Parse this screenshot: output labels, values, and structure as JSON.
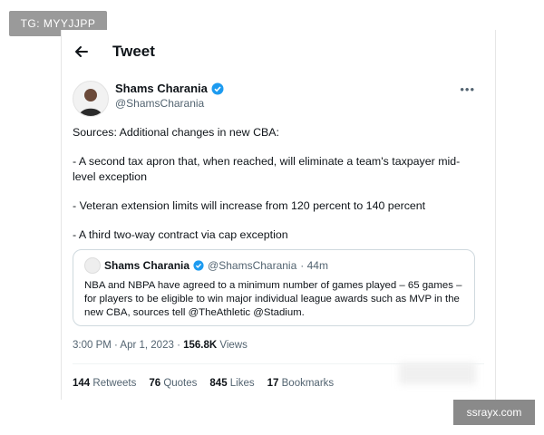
{
  "watermark_top": "TG: MYYJJPP",
  "watermark_bottom": "ssrayx.com",
  "header": {
    "title": "Tweet",
    "back_icon": "arrow-left-icon"
  },
  "tweet": {
    "author_name": "Shams Charania",
    "author_handle": "@ShamsCharania",
    "more_label": "•••",
    "body": [
      "Sources: Additional changes in new CBA:",
      "- A second tax apron that, when reached, will eliminate a team's taxpayer mid-level exception",
      "- Veteran extension limits will increase from 120 percent to 140 percent",
      "- A third two-way contract via cap exception"
    ],
    "quote": {
      "name": "Shams Charania",
      "handle": "@ShamsCharania",
      "time": "· 44m",
      "text": "NBA and NBPA have agreed to a minimum number of games played – 65 games – for players to be eligible to win major individual league awards such as MVP in the new CBA, sources tell @TheAthletic @Stadium."
    },
    "time": "3:00 PM · Apr 1, 2023 · ",
    "views_count": "156.8K",
    "views_label": " Views",
    "stats": {
      "retweets_count": "144",
      "retweets_label": " Retweets",
      "quotes_count": "76",
      "quotes_label": " Quotes",
      "likes_count": "845",
      "likes_label": " Likes",
      "bookmarks_count": "17",
      "bookmarks_label": " Bookmarks"
    }
  },
  "colors": {
    "verified": "#1d9bf0",
    "muted": "#536471",
    "text": "#0f1419"
  }
}
